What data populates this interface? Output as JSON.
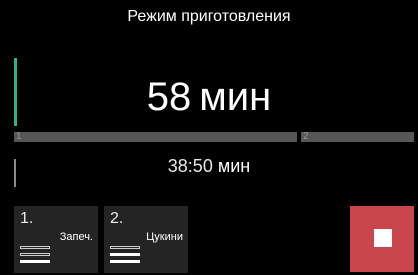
{
  "header": {
    "title": "Режим приготовления"
  },
  "timer": {
    "total_value": "58",
    "total_unit": "мин",
    "remaining_value": "38:50",
    "remaining_unit": "мин"
  },
  "progress": {
    "segments": [
      {
        "label": "1"
      },
      {
        "label": "2"
      }
    ]
  },
  "steps": [
    {
      "number": "1.",
      "name": "Запеч.",
      "heat_levels_on": 1
    },
    {
      "number": "2.",
      "name": "Цукини",
      "heat_levels_on": 2
    }
  ],
  "colors": {
    "accent": "#2bb58f",
    "stop_button": "#c9474c",
    "background": "#000000"
  },
  "icons": {
    "stop": "stop-square-icon"
  }
}
